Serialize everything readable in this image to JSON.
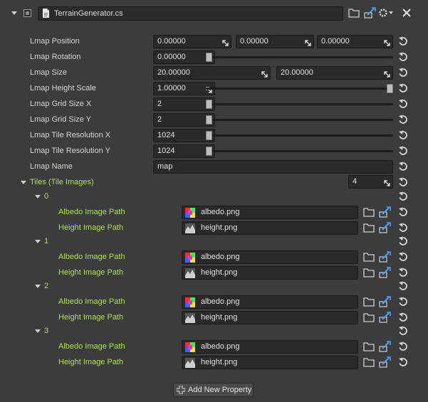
{
  "component": {
    "name": "TerrainGenerator.cs"
  },
  "properties": [
    {
      "label": "Lmap Position",
      "fields": [
        "0.00000",
        "0.00000",
        "0.00000"
      ]
    },
    {
      "label": "Lmap Rotation",
      "fields": [
        "0.00000"
      ],
      "slider": 0.0
    },
    {
      "label": "Lmap Size",
      "fields": [
        "20.00000",
        "20.00000"
      ]
    },
    {
      "label": "Lmap Height Scale",
      "fields": [
        "1.00000"
      ],
      "slider": 1.0
    },
    {
      "label": "Lmap Grid Size X",
      "fields": [
        "2"
      ],
      "slider": 0.0
    },
    {
      "label": "Lmap Grid Size Y",
      "fields": [
        "2"
      ],
      "slider": 0.0
    },
    {
      "label": "Lmap Tile Resolution X",
      "fields": [
        "1024"
      ],
      "slider": 0.0
    },
    {
      "label": "Lmap Tile Resolution Y",
      "fields": [
        "1024"
      ],
      "slider": 0.0
    },
    {
      "label": "Lmap Name",
      "fields": [
        "map"
      ]
    }
  ],
  "tiles": {
    "label": "Tiles (Tile Images)",
    "count": "4",
    "items": [
      {
        "index": "0",
        "albedo_label": "Albedo Image Path",
        "albedo": "albedo.png",
        "height_label": "Height Image Path",
        "height": "height.png"
      },
      {
        "index": "1",
        "albedo_label": "Albedo Image Path",
        "albedo": "albedo.png",
        "height_label": "Height Image Path",
        "height": "height.png"
      },
      {
        "index": "2",
        "albedo_label": "Albedo Image Path",
        "albedo": "albedo.png",
        "height_label": "Height Image Path",
        "height": "height.png"
      },
      {
        "index": "3",
        "albedo_label": "Albedo Image Path",
        "albedo": "albedo.png",
        "height_label": "Height Image Path",
        "height": "height.png"
      }
    ]
  },
  "add_button": "Add New Property",
  "icons": {
    "folder": "folder-icon",
    "pick": "pick-icon",
    "gear": "gear-icon",
    "close": "close-icon",
    "revert": "revert-icon",
    "script": "script-file-icon",
    "drag": "drag-arrows-icon",
    "plus": "plus-icon"
  },
  "colors": {
    "accent_green": "#a9e34b",
    "background": "#3c3c3e",
    "field": "#2a2a2a"
  }
}
